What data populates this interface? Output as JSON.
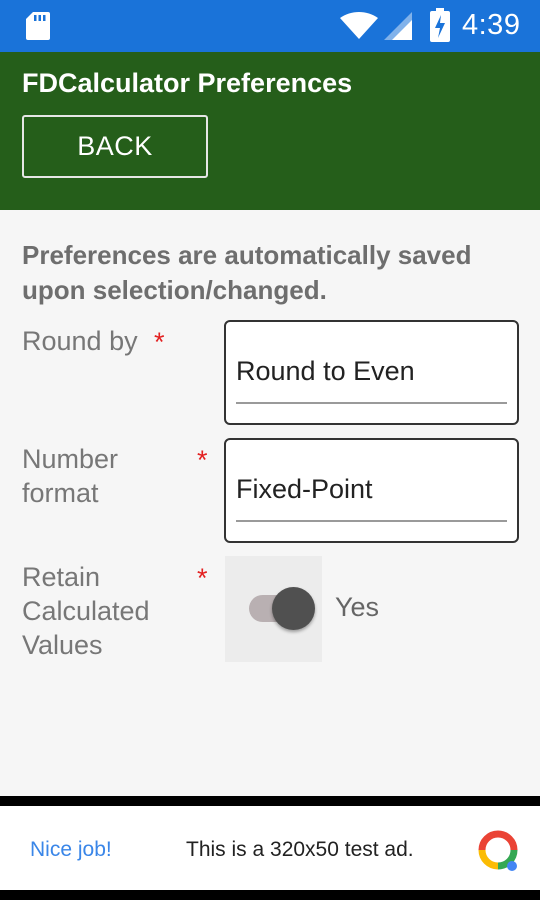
{
  "status_bar": {
    "time": "4:39",
    "icons": [
      "sd-card-icon",
      "wifi-icon",
      "cell-signal-icon",
      "battery-charging-icon"
    ]
  },
  "header": {
    "title": "FDCalculator Preferences",
    "back_label": "BACK"
  },
  "notice": "Preferences are automatically saved upon selection/changed.",
  "fields": {
    "round_by": {
      "label": "Round by",
      "required_mark": "*",
      "value": "Round to Even"
    },
    "number_format": {
      "label": "Number format",
      "required_mark": "*",
      "value": "Fixed-Point"
    },
    "retain": {
      "label": "Retain Calculated Values",
      "required_mark": "*",
      "value_label": "Yes",
      "on": true
    }
  },
  "ad": {
    "cta": "Nice job!",
    "text": "This is a 320x50 test ad.",
    "logo_icon": "google-ads-logo-icon"
  },
  "colors": {
    "status_bar": "#1a73d9",
    "header": "#255e1a",
    "required": "#e32020",
    "ad_link": "#3a86e8"
  }
}
